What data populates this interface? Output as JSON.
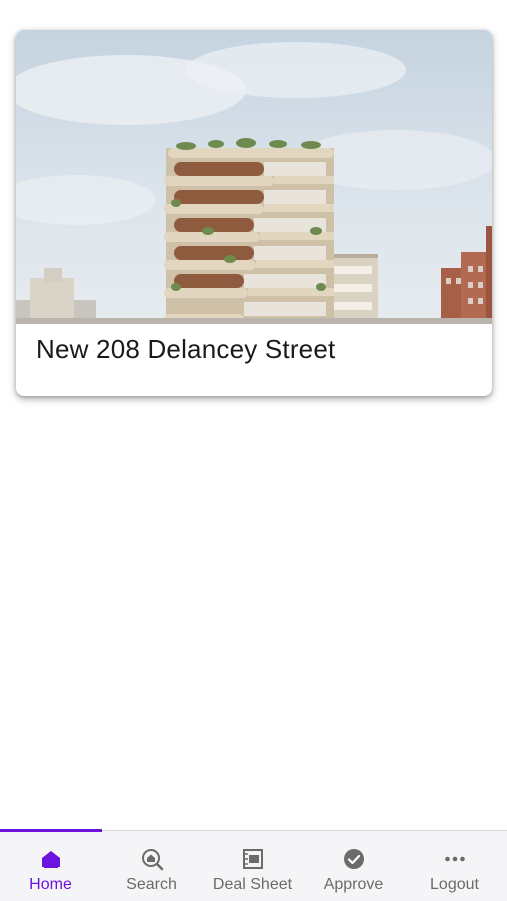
{
  "listing": {
    "title": "New 208 Delancey Street",
    "image_description": "building-rendering"
  },
  "bottom_nav": {
    "active_color": "#6d13e0",
    "inactive_color": "#6b6b6b",
    "items": [
      {
        "label": "Home",
        "icon": "home-icon",
        "active": true
      },
      {
        "label": "Search",
        "icon": "search-home-icon",
        "active": false
      },
      {
        "label": "Deal Sheet",
        "icon": "deal-sheet-icon",
        "active": false
      },
      {
        "label": "Approve",
        "icon": "approve-check-icon",
        "active": false
      },
      {
        "label": "Logout",
        "icon": "more-dots-icon",
        "active": false
      }
    ]
  }
}
